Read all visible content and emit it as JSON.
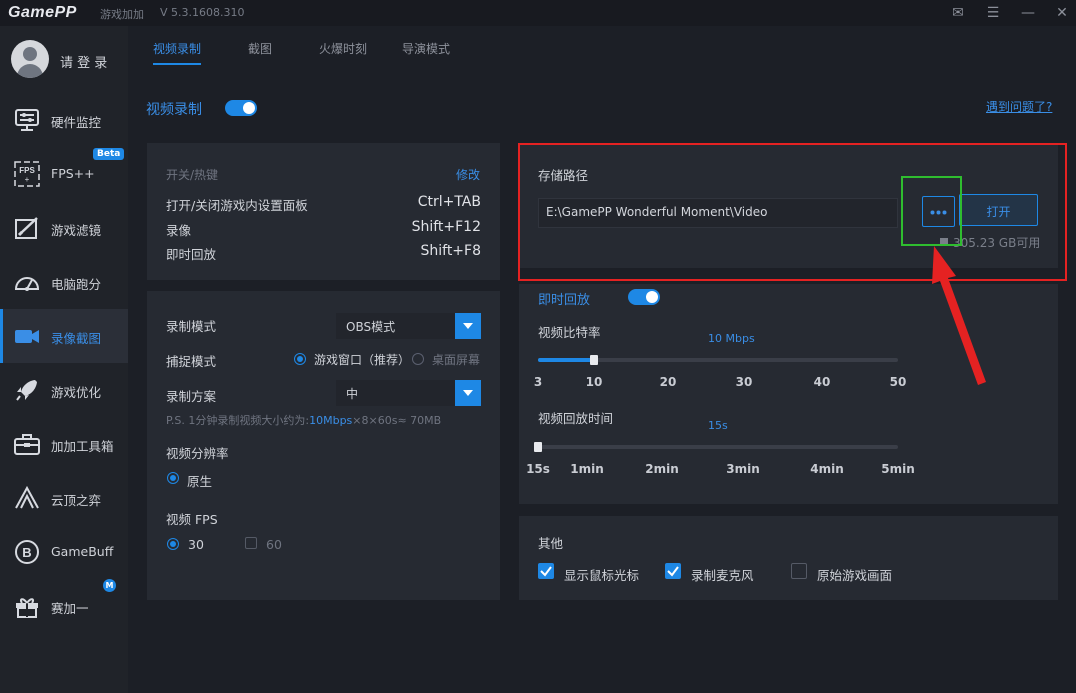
{
  "titlebar": {
    "logo": "GamePP",
    "subtitle": "游戏加加",
    "version": "V 5.3.1608.310"
  },
  "sidebar": {
    "login": "请 登 录",
    "items": [
      {
        "label": "硬件监控",
        "icon": "hardware-monitor-icon"
      },
      {
        "label": "FPS++",
        "icon": "fps-icon",
        "badge": "Beta"
      },
      {
        "label": "游戏滤镜",
        "icon": "filter-icon"
      },
      {
        "label": "电脑跑分",
        "icon": "benchmark-gauge-icon"
      },
      {
        "label": "录像截图",
        "icon": "camera-icon",
        "active": true
      },
      {
        "label": "游戏优化",
        "icon": "rocket-icon"
      },
      {
        "label": "加加工具箱",
        "icon": "toolbox-icon"
      },
      {
        "label": "云顶之弈",
        "icon": "tft-icon"
      },
      {
        "label": "GameBuff",
        "icon": "gamebuff-icon"
      },
      {
        "label": "赛加一",
        "icon": "gift-icon",
        "badge": "M"
      }
    ]
  },
  "tabs": [
    "视频录制",
    "截图",
    "火爆时刻",
    "导演模式"
  ],
  "header": {
    "title": "视频录制",
    "help_link": "遇到问题了?"
  },
  "hotkeys": {
    "title": "开关/热键",
    "edit": "修改",
    "rows": [
      {
        "label": "打开/关闭游戏内设置面板",
        "key": "Ctrl+TAB"
      },
      {
        "label": "录像",
        "key": "Shift+F12"
      },
      {
        "label": "即时回放",
        "key": "Shift+F8"
      }
    ]
  },
  "record": {
    "mode_label": "录制模式",
    "mode_value": "OBS模式",
    "capture_label": "捕捉模式",
    "capture_opt1": "游戏窗口（推荐）",
    "capture_opt2": "桌面屏幕",
    "scheme_label": "录制方案",
    "scheme_value": "中",
    "ps_prefix": "P.S. 1分钟录制视频大小约为:",
    "ps_rate": "10Mbps",
    "ps_suffix": "×8×60s≈ 70MB",
    "res_label": "视频分辨率",
    "res_value": "原生",
    "fps_label": "视频 FPS",
    "fps_opt1": "30",
    "fps_opt2": "60"
  },
  "storage": {
    "title": "存储路径",
    "path": "E:\\GamePP Wonderful Moment\\Video",
    "dots": "•••",
    "open": "打开",
    "free": "305.23 GB可用"
  },
  "replay": {
    "title": "即时回放",
    "bitrate_label": "视频比特率",
    "bitrate_value": "10 Mbps",
    "bitrate_fraction": 0.149,
    "bitrate_ticks": [
      "3",
      "10",
      "20",
      "30",
      "40",
      "50"
    ],
    "time_label": "视频回放时间",
    "time_value": "15s",
    "time_fraction": 0.0,
    "time_ticks": [
      "15s",
      "1min",
      "2min",
      "3min",
      "4min",
      "5min"
    ]
  },
  "other": {
    "title": "其他",
    "options": [
      {
        "label": "显示鼠标光标",
        "checked": true
      },
      {
        "label": "录制麦克风",
        "checked": true
      },
      {
        "label": "原始游戏画面",
        "checked": false
      }
    ]
  },
  "colors": {
    "accent": "#1e88e5",
    "highlight_red": "#e52222",
    "highlight_green": "#2fbd2f"
  }
}
